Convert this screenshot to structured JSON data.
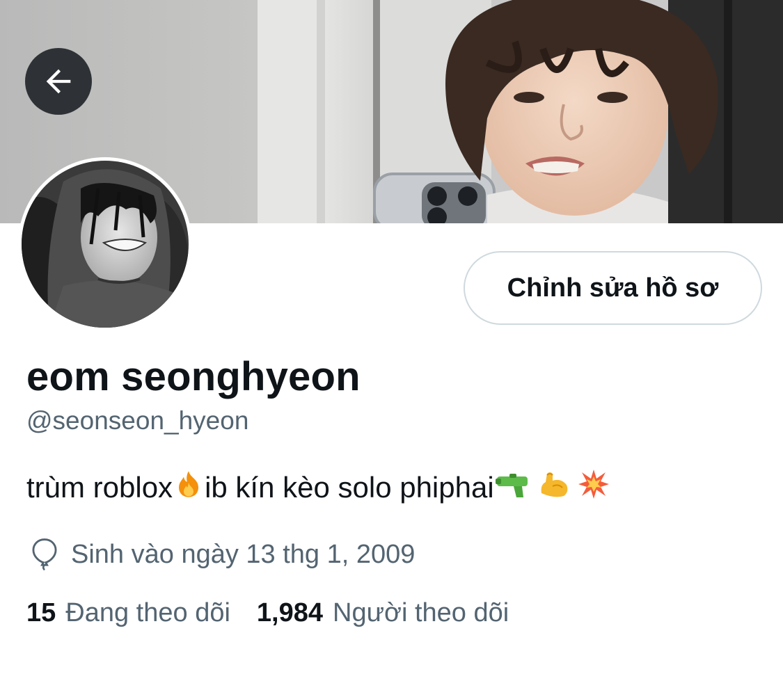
{
  "profile": {
    "display_name": "eom seonghyeon",
    "handle": "@seonseon_hyeon",
    "bio_text_1": "trùm roblox",
    "bio_text_2": " ib kín kèo solo phiphai",
    "bio_emojis": [
      "fire-icon",
      "water-gun-icon",
      "flexed-biceps-icon",
      "collision-icon"
    ],
    "birth_text": "Sinh vào ngày 13 thg 1, 2009"
  },
  "actions": {
    "edit_profile_label": "Chỉnh sửa hồ sơ",
    "back_icon": "arrow-left-icon"
  },
  "stats": {
    "following_count": "15",
    "following_label": "Đang theo dõi",
    "followers_count": "1,984",
    "followers_label": "Người theo dõi"
  },
  "colors": {
    "text_primary": "#0f1419",
    "text_secondary": "#536471",
    "border": "#cfd9de"
  }
}
